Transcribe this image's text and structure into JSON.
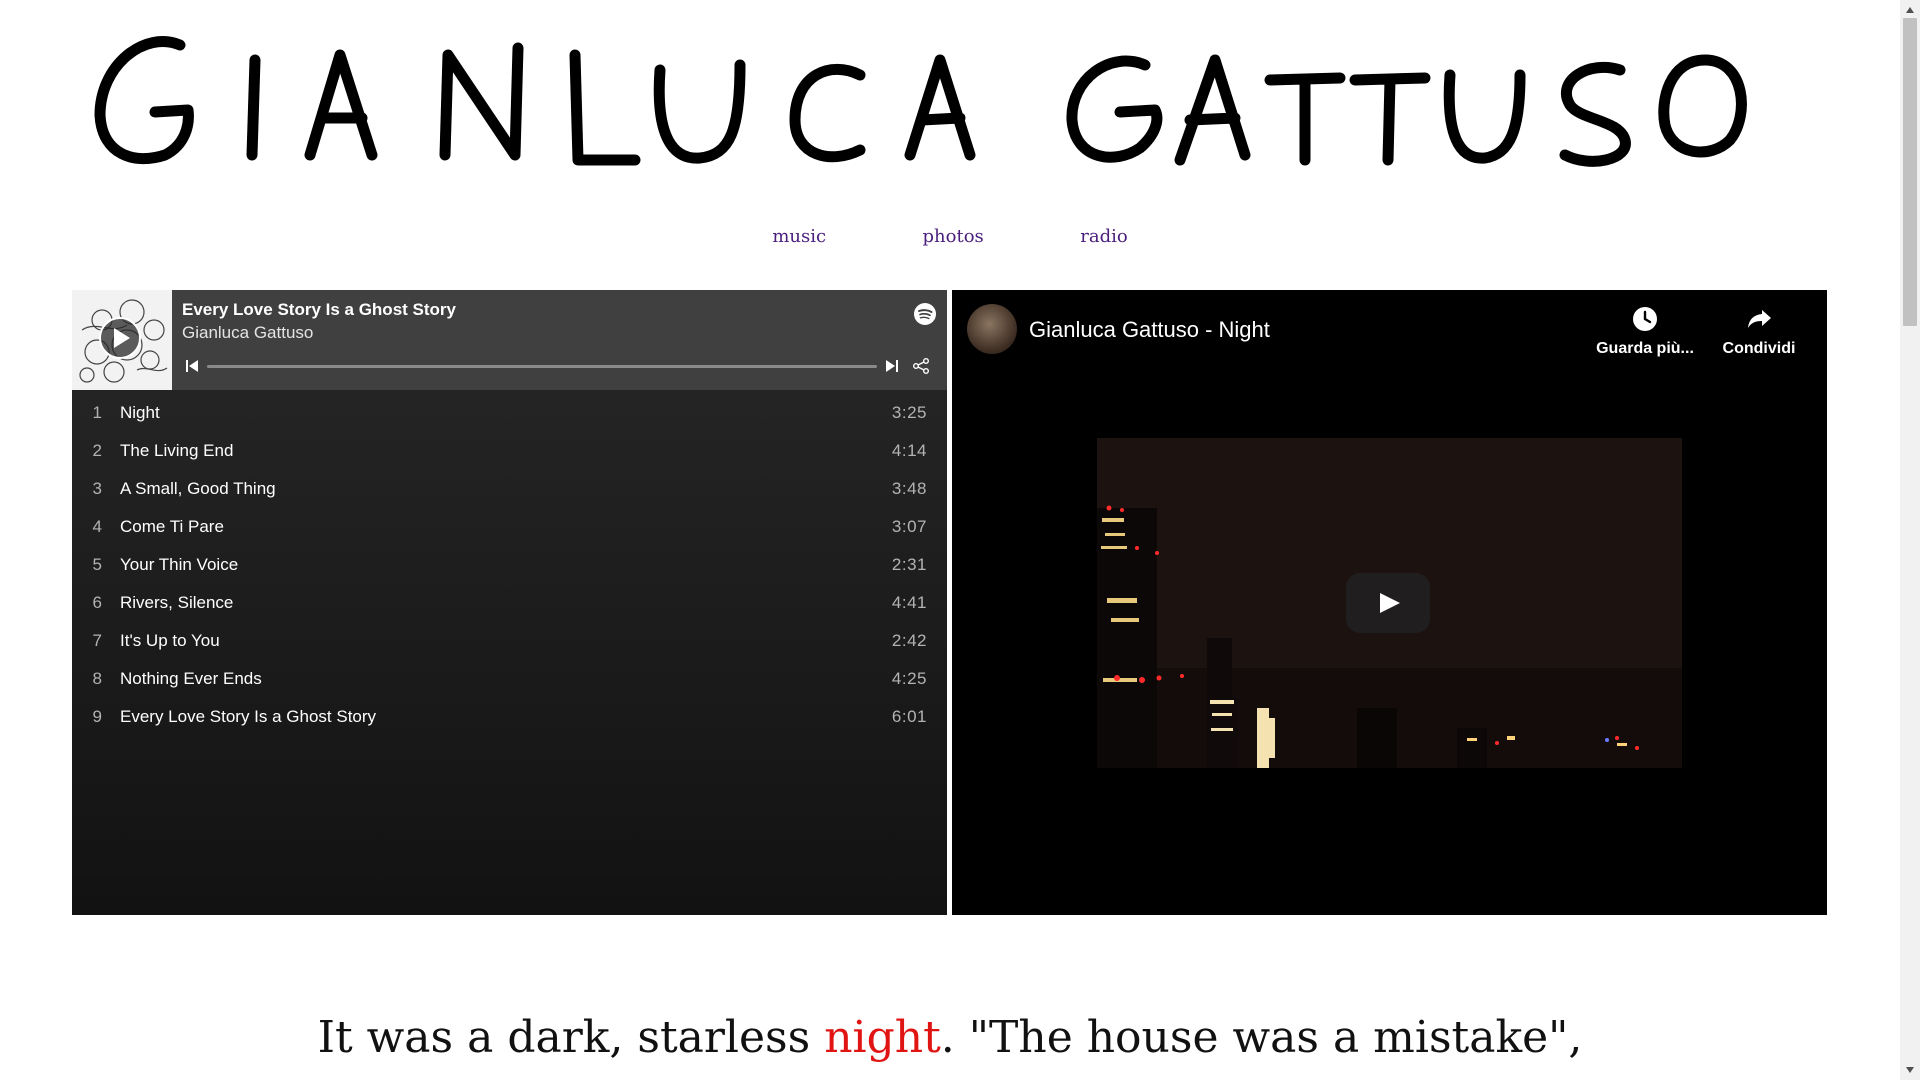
{
  "site": {
    "logo_text": "GIANLUCA GATTUSO"
  },
  "nav": {
    "items": [
      {
        "label": "music"
      },
      {
        "label": "photos"
      },
      {
        "label": "radio"
      }
    ]
  },
  "spotify": {
    "title": "Every Love Story Is a Ghost Story",
    "artist": "Gianluca Gattuso",
    "icons": [
      "play-icon",
      "spotify-logo-icon",
      "skip-back-icon",
      "skip-forward-icon",
      "share-icon"
    ],
    "tracks": [
      {
        "num": "1",
        "name": "Night",
        "duration": "3:25"
      },
      {
        "num": "2",
        "name": "The Living End",
        "duration": "4:14"
      },
      {
        "num": "3",
        "name": "A Small, Good Thing",
        "duration": "3:48"
      },
      {
        "num": "4",
        "name": "Come Ti Pare",
        "duration": "3:07"
      },
      {
        "num": "5",
        "name": "Your Thin Voice",
        "duration": "2:31"
      },
      {
        "num": "6",
        "name": "Rivers, Silence",
        "duration": "4:41"
      },
      {
        "num": "7",
        "name": "It's Up to You",
        "duration": "2:42"
      },
      {
        "num": "8",
        "name": "Nothing Ever Ends",
        "duration": "4:25"
      },
      {
        "num": "9",
        "name": "Every Love Story Is a Ghost Story",
        "duration": "6:01"
      }
    ]
  },
  "youtube": {
    "title": "Gianluca Gattuso - Night",
    "watch_later_label": "Guarda più...",
    "share_label": "Condividi",
    "icons": [
      "clock-icon",
      "share-arrow-icon",
      "play-icon"
    ]
  },
  "story": {
    "before": "It was a dark, starless ",
    "highlight": "night",
    "after": ". \"The house was a mistake\","
  },
  "colors": {
    "nav_link": "#4b1e7e",
    "story_highlight": "#e11414",
    "spotify_bg": "#282828",
    "youtube_bg": "#000000"
  }
}
